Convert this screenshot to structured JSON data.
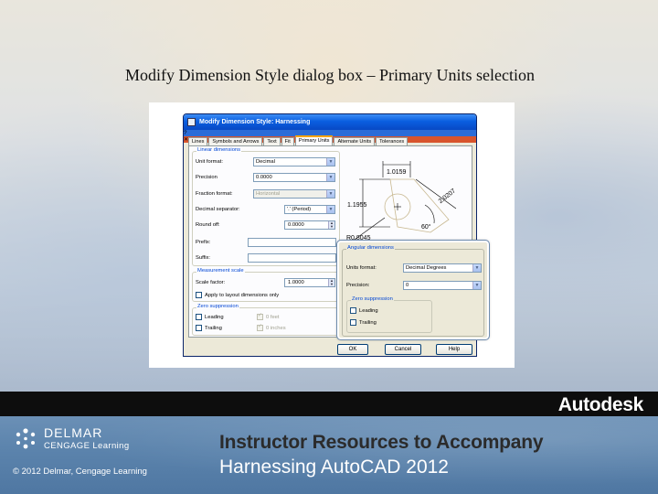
{
  "slide": {
    "title": "Modify Dimension Style dialog box – Primary Units selection",
    "footer_brand": "Autodesk",
    "publisher_name": "DELMAR",
    "publisher_sub": "CENGAGE Learning",
    "copyright": "© 2012 Delmar, Cengage Learning",
    "heading": "Instructor Resources to Accompany",
    "subheading": "Harnessing AutoCAD 2012"
  },
  "dialog": {
    "title": "Modify Dimension Style: Harnessing",
    "tabs": [
      "Lines",
      "Symbols and Arrows",
      "Text",
      "Fit",
      "Primary Units",
      "Alternate Units",
      "Tolerances"
    ],
    "active_tab": "Primary Units",
    "linear": {
      "group_label": "Linear dimensions",
      "unit_format_label": "Unit format:",
      "unit_format_value": "Decimal",
      "precision_label": "Precision",
      "precision_value": "0.0000",
      "fraction_format_label": "Fraction format:",
      "fraction_format_value": "Horizontal",
      "decimal_separator_label": "Decimal separator:",
      "decimal_separator_value": "'.' (Period)",
      "round_off_label": "Round off:",
      "round_off_value": "0.0000",
      "prefix_label": "Prefix:",
      "suffix_label": "Suffix:"
    },
    "measurement": {
      "group_label": "Measurement scale",
      "scale_label": "Scale factor:",
      "scale_value": "1.0000",
      "apply_layout_label": "Apply to layout dimensions only"
    },
    "zero": {
      "group_label": "Zero suppression",
      "leading": "Leading",
      "trailing": "Trailing",
      "feet": "0 feet",
      "inches": "0 inches"
    },
    "preview": {
      "dim_top": "1.0159",
      "dim_left": "1.1955",
      "dim_right": "2.0207",
      "angle": "60°",
      "radius": "R0.8045"
    },
    "buttons": {
      "ok": "OK",
      "cancel": "Cancel",
      "help": "Help"
    }
  },
  "angular": {
    "group_label": "Angular dimensions",
    "units_format_label": "Units format:",
    "units_format_value": "Decimal Degrees",
    "precision_label": "Precision:",
    "precision_value": "0",
    "zero_label": "Zero suppression",
    "leading": "Leading",
    "trailing": "Trailing"
  },
  "colors": {
    "title_bar": "#0a5ee0",
    "group_label": "#0046d5",
    "footer_blue": "#5c84ad",
    "black_bar": "#0d0d0d"
  }
}
